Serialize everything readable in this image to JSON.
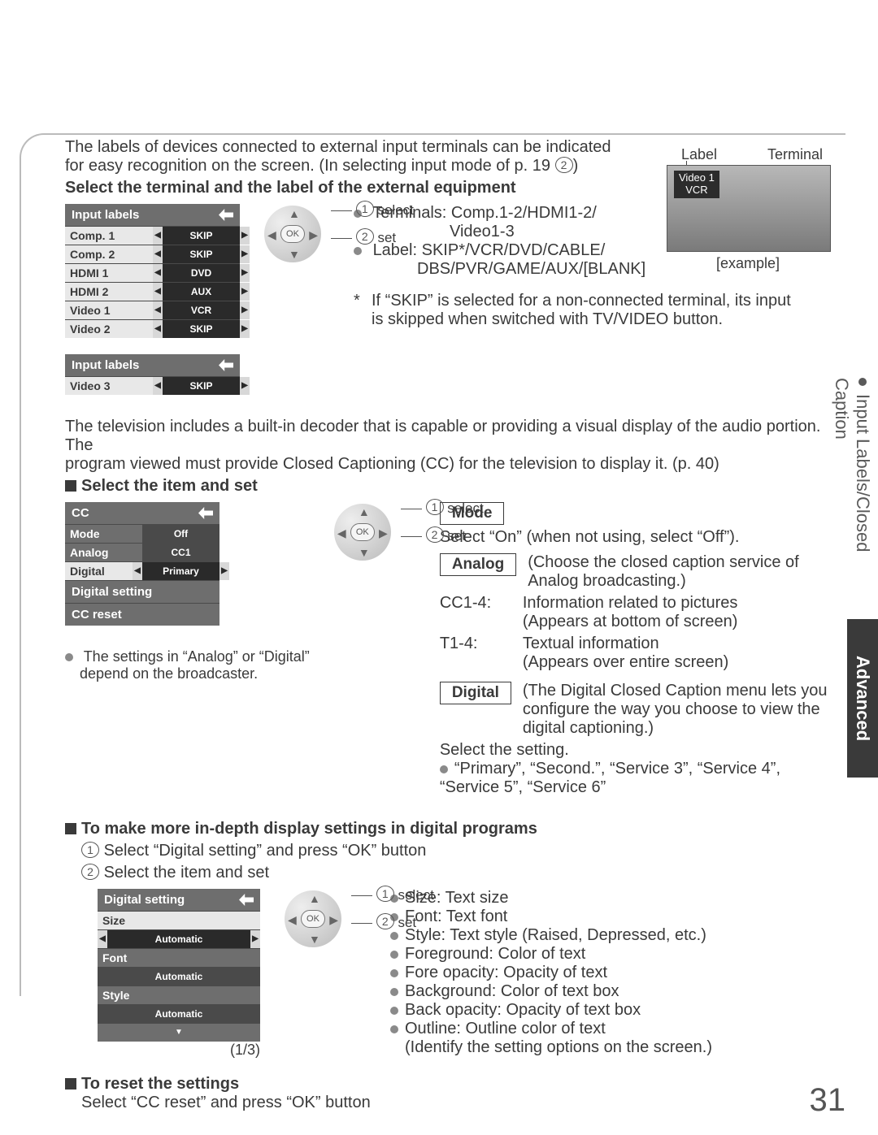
{
  "page_number": "31",
  "side_tabs": {
    "light": "Input Labels/Closed Caption",
    "dark": "Advanced"
  },
  "intro": {
    "line1": "The labels of devices connected to external input terminals can be indicated",
    "line2": "for easy recognition on the screen. (In selecting input mode of p. 19 ",
    "line2_badge": "2",
    "line2_end": ")",
    "heading": "Select the terminal and the label of the external equipment"
  },
  "tv_example": {
    "label_l": "Label",
    "label_r": "Terminal",
    "tag_top": "Video 1",
    "tag_bottom": "VCR",
    "caption": "[example]"
  },
  "dpad1": {
    "select_num": "1",
    "select_text": "select",
    "set_num": "2",
    "set_text": "set",
    "ok": "OK"
  },
  "terminals": {
    "bullet_terminals": "Terminals:",
    "terminals_val": "Comp.1-2/HDMI1-2/",
    "terminals_val2": "Video1-3",
    "bullet_label": "Label:",
    "label_val": "SKIP*/VCR/DVD/CABLE/",
    "label_val2": "DBS/PVR/GAME/AUX/[BLANK]",
    "note_star": "*",
    "note_text1": "If “SKIP” is selected for a non-connected terminal, its input",
    "note_text2": "is skipped when switched with TV/VIDEO button."
  },
  "osd_input": {
    "title": "Input labels",
    "rows1": [
      {
        "label": "Comp. 1",
        "value": "SKIP"
      },
      {
        "label": "Comp. 2",
        "value": "SKIP"
      },
      {
        "label": "HDMI 1",
        "value": "DVD"
      },
      {
        "label": "HDMI 2",
        "value": "AUX"
      },
      {
        "label": "Video 1",
        "value": "VCR"
      },
      {
        "label": "Video 2",
        "value": "SKIP"
      }
    ],
    "title2": "Input labels",
    "rows2": [
      {
        "label": "Video 3",
        "value": "SKIP"
      }
    ]
  },
  "cc_intro": {
    "line1": "The television includes a built-in decoder that is capable or providing a visual display of the audio portion. The",
    "line2": "program viewed must provide Closed Captioning (CC) for the television to display it. (p. 40)",
    "heading": "Select the item and set"
  },
  "osd_cc": {
    "title": "CC",
    "rows": [
      {
        "label": "Mode",
        "value": "Off",
        "dark": true,
        "arrows": false
      },
      {
        "label": "Analog",
        "value": "CC1",
        "dark": true,
        "arrows": false
      },
      {
        "label": "Digital",
        "value": "Primary",
        "dark": false,
        "arrows": true
      }
    ],
    "actions": [
      "Digital setting",
      "CC reset"
    ]
  },
  "dpad2": {
    "select_num": "1",
    "select_text": "select",
    "set_num": "2",
    "set_text": "set",
    "ok": "OK"
  },
  "cc_note": {
    "line1": "The settings in “Analog” or “Digital”",
    "line2": "depend on the broadcaster."
  },
  "cc_right": {
    "mode_box": "Mode",
    "mode_text": "Select “On” (when not using, select “Off”).",
    "analog_box": "Analog",
    "analog_desc": "(Choose the closed caption service of Analog broadcasting.)",
    "cc14_label": "CC1-4:",
    "cc14_desc1": "Information related to pictures",
    "cc14_desc2": "(Appears at bottom of screen)",
    "t14_label": "T1-4:",
    "t14_desc1": "Textual information",
    "t14_desc2": "(Appears over entire screen)",
    "digital_box": "Digital",
    "digital_desc": "(The Digital Closed Caption menu lets you configure the way you choose to view the digital captioning.)",
    "select_setting": "Select the setting.",
    "services": "“Primary”, “Second.”, “Service 3”, “Service 4”, “Service 5”, “Service 6”"
  },
  "digital_settings": {
    "heading": "To make more in-depth display settings in digital programs",
    "step1_num": "1",
    "step1_text": "Select “Digital setting” and press “OK” button",
    "step2_num": "2",
    "step2_text": "Select the item and set"
  },
  "osd_digital": {
    "title": "Digital setting",
    "groups": [
      {
        "label": "Size",
        "value": "Automatic"
      },
      {
        "label": "Font",
        "value": "Automatic"
      },
      {
        "label": "Style",
        "value": "Automatic"
      }
    ],
    "pager": "(1/3)"
  },
  "dpad3": {
    "select_num": "1",
    "select_text": "select",
    "set_num": "2",
    "set_text": "set",
    "ok": "OK"
  },
  "digital_bullets": [
    "Size: Text size",
    "Font: Text font",
    "Style: Text style (Raised, Depressed, etc.)",
    "Foreground: Color of text",
    "Fore opacity: Opacity of text",
    "Background: Color of text box",
    "Back opacity: Opacity of text box",
    "Outline: Outline color of text"
  ],
  "digital_bullets_tail": "(Identify the setting options on the screen.)",
  "reset": {
    "heading": "To reset the settings",
    "text": "Select “CC reset” and press “OK” button"
  }
}
